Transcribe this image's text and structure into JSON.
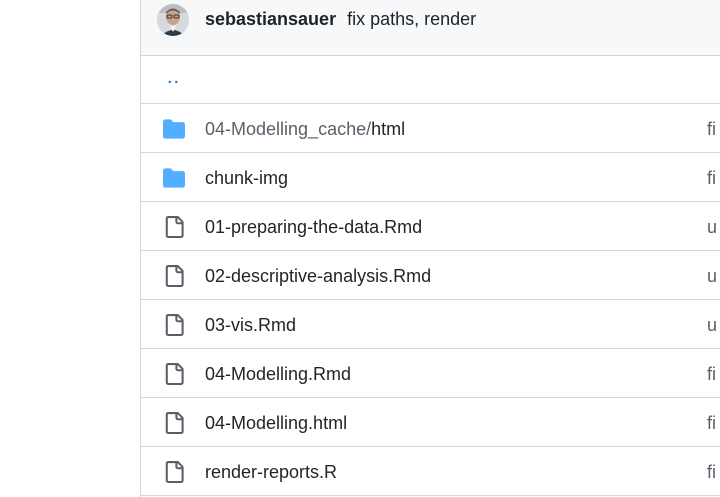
{
  "commit": {
    "author": "sebastiansauer",
    "message": "fix paths, render"
  },
  "parent_link": "..",
  "rows": [
    {
      "type": "folder",
      "prefix": "04-Modelling_cache/",
      "name": "html",
      "commit": "fi"
    },
    {
      "type": "folder",
      "prefix": "",
      "name": "chunk-img",
      "commit": "fi"
    },
    {
      "type": "file",
      "prefix": "",
      "name": "01-preparing-the-data.Rmd",
      "commit": "u"
    },
    {
      "type": "file",
      "prefix": "",
      "name": "02-descriptive-analysis.Rmd",
      "commit": "u"
    },
    {
      "type": "file",
      "prefix": "",
      "name": "03-vis.Rmd",
      "commit": "u"
    },
    {
      "type": "file",
      "prefix": "",
      "name": "04-Modelling.Rmd",
      "commit": "fi"
    },
    {
      "type": "file",
      "prefix": "",
      "name": "04-Modelling.html",
      "commit": "fi"
    },
    {
      "type": "file",
      "prefix": "",
      "name": "render-reports.R",
      "commit": "fi"
    }
  ],
  "colors": {
    "folder": "#54aeff",
    "file_icon": "#57606a",
    "link": "#0969da"
  },
  "icons": {
    "folder": "folder-icon",
    "file": "file-icon"
  }
}
